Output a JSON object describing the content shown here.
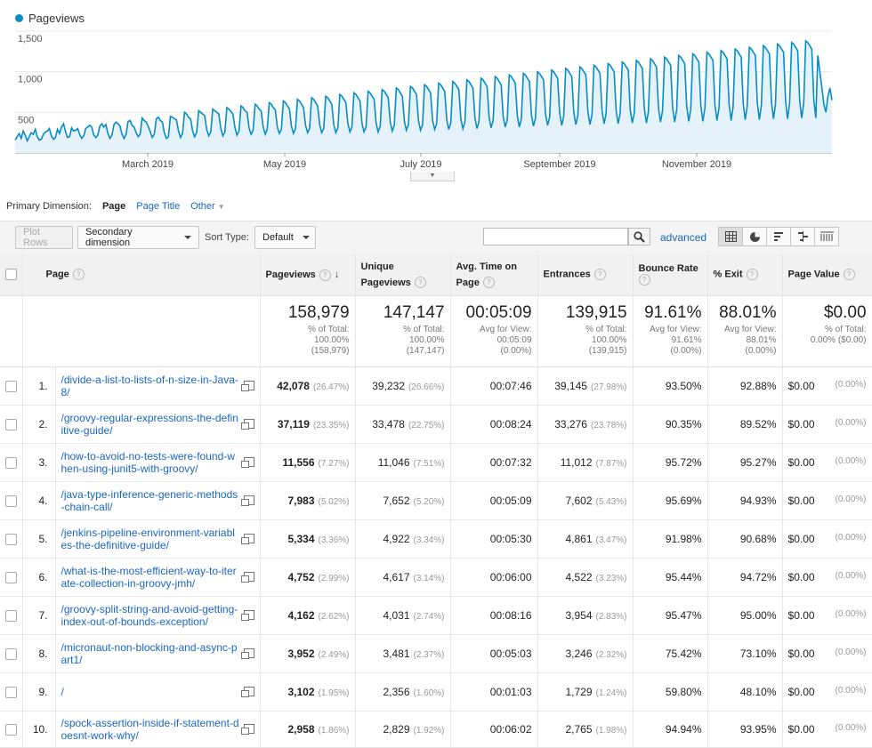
{
  "chart": {
    "legend_label": "Pageviews",
    "accent_color": "#058dc7",
    "y_ticks": [
      "1,500",
      "1,000",
      "500"
    ],
    "x_ticks": [
      "March 2019",
      "May 2019",
      "July 2019",
      "September 2019",
      "November 2019"
    ]
  },
  "chart_data": {
    "type": "area",
    "title": "",
    "series": [
      {
        "name": "Pageviews",
        "values": [
          160,
          200,
          240,
          180,
          270,
          220,
          150,
          200,
          250,
          230,
          290,
          200,
          160,
          170,
          230,
          260,
          270,
          300,
          210,
          170,
          190,
          290,
          240,
          320,
          360,
          260,
          190,
          200,
          310,
          270,
          280,
          300,
          230,
          180,
          210,
          300,
          320,
          340,
          320,
          220,
          190,
          220,
          330,
          360,
          320,
          350,
          240,
          180,
          220,
          350,
          380,
          360,
          330,
          230,
          180,
          230,
          390,
          400,
          340,
          320,
          250,
          200,
          230,
          430,
          400,
          380,
          330,
          260,
          190,
          230,
          420,
          440,
          400,
          380,
          250,
          180,
          200,
          450,
          440,
          420,
          410,
          270,
          190,
          240,
          500,
          480,
          440,
          420,
          270,
          200,
          250,
          520,
          500,
          480,
          460,
          290,
          210,
          260,
          540,
          520,
          500,
          480,
          300,
          210,
          260,
          560,
          540,
          510,
          480,
          310,
          220,
          270,
          580,
          560,
          520,
          500,
          310,
          230,
          280,
          600,
          580,
          540,
          520,
          320,
          230,
          290,
          620,
          600,
          560,
          530,
          320,
          240,
          290,
          640,
          620,
          580,
          540,
          330,
          240,
          300,
          660,
          640,
          600,
          560,
          340,
          250,
          300,
          680,
          660,
          620,
          580,
          350,
          250,
          300,
          700,
          680,
          640,
          600,
          350,
          250,
          310,
          720,
          700,
          660,
          620,
          360,
          260,
          320,
          740,
          720,
          680,
          640,
          360,
          260,
          320,
          760,
          740,
          700,
          660,
          370,
          260,
          330,
          780,
          760,
          720,
          680,
          380,
          270,
          340,
          800,
          780,
          740,
          700,
          390,
          280,
          350,
          820,
          800,
          760,
          720,
          400,
          280,
          350,
          840,
          820,
          780,
          740,
          400,
          290,
          360,
          860,
          840,
          800,
          760,
          410,
          290,
          370,
          880,
          860,
          820,
          780,
          420,
          300,
          380,
          900,
          880,
          840,
          800,
          430,
          300,
          390,
          920,
          900,
          860,
          820,
          440,
          310,
          400,
          940,
          920,
          880,
          840,
          450,
          320,
          410,
          960,
          940,
          900,
          860,
          460,
          320,
          420,
          980,
          960,
          920,
          880,
          470,
          330,
          430,
          1000,
          980,
          940,
          900,
          480,
          340,
          440,
          1020,
          1000,
          960,
          920,
          490,
          340,
          450,
          1040,
          1020,
          980,
          940,
          500,
          350,
          460,
          1060,
          1040,
          1000,
          960,
          510,
          350,
          470,
          1080,
          1060,
          1020,
          980,
          520,
          360,
          480,
          1100,
          1080,
          1040,
          1000,
          520,
          360,
          490,
          1120,
          1100,
          1060,
          1020,
          530,
          370,
          500,
          1140,
          1120,
          1080,
          1040,
          540,
          370,
          510,
          1160,
          1140,
          1100,
          1060,
          550,
          380,
          520,
          1180,
          1160,
          1120,
          1080,
          560,
          380,
          530,
          1200,
          1180,
          1140,
          1100,
          570,
          390,
          540,
          1220,
          1200,
          1160,
          1120,
          580,
          390,
          550,
          1240,
          1220,
          1180,
          1140,
          590,
          400,
          560,
          1260,
          1240,
          1200,
          1160,
          600,
          400,
          570,
          1280,
          1260,
          1220,
          1180,
          610,
          410,
          580,
          1300,
          1280,
          1240,
          1200,
          620,
          410,
          590,
          1320,
          1300,
          1260,
          1220,
          630,
          420,
          600,
          1340,
          1320,
          1280,
          1240,
          640,
          420,
          610,
          1360,
          1340,
          1300,
          1260,
          650,
          430,
          620,
          1380,
          1360,
          1320,
          1280,
          660,
          430,
          1200,
          1000,
          800,
          600,
          500,
          700,
          800,
          650
        ]
      }
    ],
    "ylim": [
      0,
      1500
    ],
    "x_ticks": [
      "March 2019",
      "May 2019",
      "July 2019",
      "September 2019",
      "November 2019"
    ],
    "y_ticks": [
      500,
      1000,
      1500
    ],
    "grid": true
  },
  "primary_dimension": {
    "label": "Primary Dimension:",
    "options": [
      "Page",
      "Page Title",
      "Other"
    ]
  },
  "toolbar": {
    "plot_rows": "Plot Rows",
    "secondary_dimension": "Secondary dimension",
    "sort_type_label": "Sort Type:",
    "sort_type_value": "Default",
    "search_value": "",
    "advanced": "advanced"
  },
  "table": {
    "headers": {
      "page": "Page",
      "pageviews": "Pageviews",
      "unique_pageviews": "Unique Pageviews",
      "avg_time": "Avg. Time on Page",
      "entrances": "Entrances",
      "bounce_rate": "Bounce Rate",
      "exit": "% Exit",
      "page_value": "Page Value"
    },
    "totals": {
      "pageviews": "158,979",
      "pageviews_sub1": "% of Total:",
      "pageviews_sub2": "100.00%",
      "pageviews_sub3": "(158,979)",
      "unique": "147,147",
      "unique_sub1": "% of Total:",
      "unique_sub2": "100.00%",
      "unique_sub3": "(147,147)",
      "avg_time": "00:05:09",
      "avg_time_sub1": "Avg for View:",
      "avg_time_sub2": "00:05:09",
      "avg_time_sub3": "(0.00%)",
      "entrances": "139,915",
      "entrances_sub1": "% of Total:",
      "entrances_sub2": "100.00%",
      "entrances_sub3": "(139,915)",
      "bounce": "91.61%",
      "bounce_sub1": "Avg for View:",
      "bounce_sub2": "91.61%",
      "bounce_sub3": "(0.00%)",
      "exit": "88.01%",
      "exit_sub1": "Avg for View:",
      "exit_sub2": "88.01%",
      "exit_sub3": "(0.00%)",
      "value": "$0.00",
      "value_sub1": "% of Total:",
      "value_sub2": "0.00% ($0.00)"
    },
    "rows": [
      {
        "rank": "1.",
        "page": "/divide-a-list-to-lists-of-n-size-in-Java-8/",
        "pv": "42,078",
        "pv_pct": "(26.47%)",
        "upv": "39,232",
        "upv_pct": "(26.66%)",
        "time": "00:07:46",
        "ent": "39,145",
        "ent_pct": "(27.98%)",
        "bounce": "93.50%",
        "exit": "92.88%",
        "value": "$0.00",
        "value_pct": "(0.00%)"
      },
      {
        "rank": "2.",
        "page": "/groovy-regular-expressions-the-definitive-guide/",
        "pv": "37,119",
        "pv_pct": "(23.35%)",
        "upv": "33,478",
        "upv_pct": "(22.75%)",
        "time": "00:08:24",
        "ent": "33,276",
        "ent_pct": "(23.78%)",
        "bounce": "90.35%",
        "exit": "89.52%",
        "value": "$0.00",
        "value_pct": "(0.00%)"
      },
      {
        "rank": "3.",
        "page": "/how-to-avoid-no-tests-were-found-when-using-junit5-with-groovy/",
        "pv": "11,556",
        "pv_pct": "(7.27%)",
        "upv": "11,046",
        "upv_pct": "(7.51%)",
        "time": "00:07:32",
        "ent": "11,012",
        "ent_pct": "(7.87%)",
        "bounce": "95.72%",
        "exit": "95.27%",
        "value": "$0.00",
        "value_pct": "(0.00%)"
      },
      {
        "rank": "4.",
        "page": "/java-type-inference-generic-methods-chain-call/",
        "pv": "7,983",
        "pv_pct": "(5.02%)",
        "upv": "7,652",
        "upv_pct": "(5.20%)",
        "time": "00:05:09",
        "ent": "7,602",
        "ent_pct": "(5.43%)",
        "bounce": "95.69%",
        "exit": "94.93%",
        "value": "$0.00",
        "value_pct": "(0.00%)"
      },
      {
        "rank": "5.",
        "page": "/jenkins-pipeline-environment-variables-the-definitive-guide/",
        "pv": "5,334",
        "pv_pct": "(3.36%)",
        "upv": "4,922",
        "upv_pct": "(3.34%)",
        "time": "00:05:30",
        "ent": "4,861",
        "ent_pct": "(3.47%)",
        "bounce": "91.98%",
        "exit": "90.68%",
        "value": "$0.00",
        "value_pct": "(0.00%)"
      },
      {
        "rank": "6.",
        "page": "/what-is-the-most-efficient-way-to-iterate-collection-in-groovy-jmh/",
        "pv": "4,752",
        "pv_pct": "(2.99%)",
        "upv": "4,617",
        "upv_pct": "(3.14%)",
        "time": "00:06:00",
        "ent": "4,522",
        "ent_pct": "(3.23%)",
        "bounce": "95.44%",
        "exit": "94.72%",
        "value": "$0.00",
        "value_pct": "(0.00%)"
      },
      {
        "rank": "7.",
        "page": "/groovy-split-string-and-avoid-getting-index-out-of-bounds-exception/",
        "pv": "4,162",
        "pv_pct": "(2.62%)",
        "upv": "4,031",
        "upv_pct": "(2.74%)",
        "time": "00:08:16",
        "ent": "3,954",
        "ent_pct": "(2.83%)",
        "bounce": "95.47%",
        "exit": "95.00%",
        "value": "$0.00",
        "value_pct": "(0.00%)"
      },
      {
        "rank": "8.",
        "page": "/micronaut-non-blocking-and-async-part1/",
        "pv": "3,952",
        "pv_pct": "(2.49%)",
        "upv": "3,481",
        "upv_pct": "(2.37%)",
        "time": "00:05:03",
        "ent": "3,246",
        "ent_pct": "(2.32%)",
        "bounce": "75.42%",
        "exit": "73.10%",
        "value": "$0.00",
        "value_pct": "(0.00%)"
      },
      {
        "rank": "9.",
        "page": "/",
        "pv": "3,102",
        "pv_pct": "(1.95%)",
        "upv": "2,356",
        "upv_pct": "(1.60%)",
        "time": "00:01:03",
        "ent": "1,729",
        "ent_pct": "(1.24%)",
        "bounce": "59.80%",
        "exit": "48.10%",
        "value": "$0.00",
        "value_pct": "(0.00%)"
      },
      {
        "rank": "10.",
        "page": "/spock-assertion-inside-if-statement-doesnt-work-why/",
        "pv": "2,958",
        "pv_pct": "(1.86%)",
        "upv": "2,829",
        "upv_pct": "(1.92%)",
        "time": "00:06:02",
        "ent": "2,765",
        "ent_pct": "(1.98%)",
        "bounce": "94.94%",
        "exit": "93.95%",
        "value": "$0.00",
        "value_pct": "(0.00%)"
      }
    ]
  }
}
